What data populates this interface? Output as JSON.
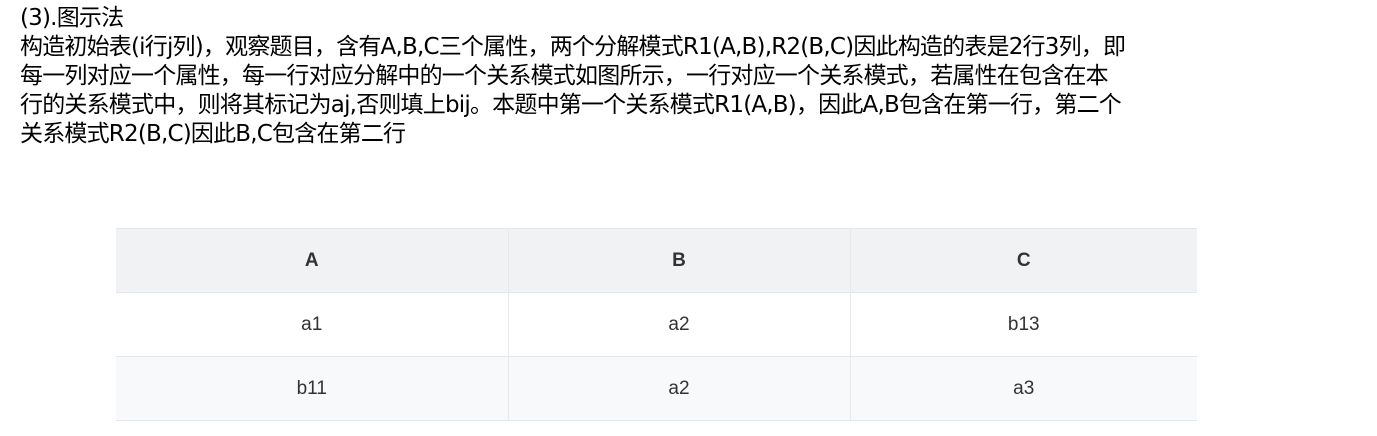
{
  "text": {
    "heading": "(3).图示法",
    "lines": [
      "构造初始表(i行j列)，观察题目，含有A,B,C三个属性，两个分解模式R1(A,B),R2(B,C)因此构造的表是2行3列，即",
      "每一列对应一个属性，每一行对应分解中的一个关系模式如图所示，一行对应一个关系模式，若属性在包含在本",
      "行的关系模式中，则将其标记为aj,否则填上bij。本题中第一个关系模式R1(A,B)，因此A,B包含在第一行，第二个",
      "关系模式R2(B,C)因此B,C包含在第二行"
    ]
  },
  "table": {
    "headers": [
      "A",
      "B",
      "C"
    ],
    "rows": [
      [
        "a1",
        "a2",
        "b13"
      ],
      [
        "b11",
        "a2",
        "a3"
      ]
    ]
  },
  "colors": {
    "header_bg": "#f1f2f4",
    "alt_row_bg": "#f8f9fa",
    "border": "#e3e6ea",
    "table_text": "#333333"
  }
}
